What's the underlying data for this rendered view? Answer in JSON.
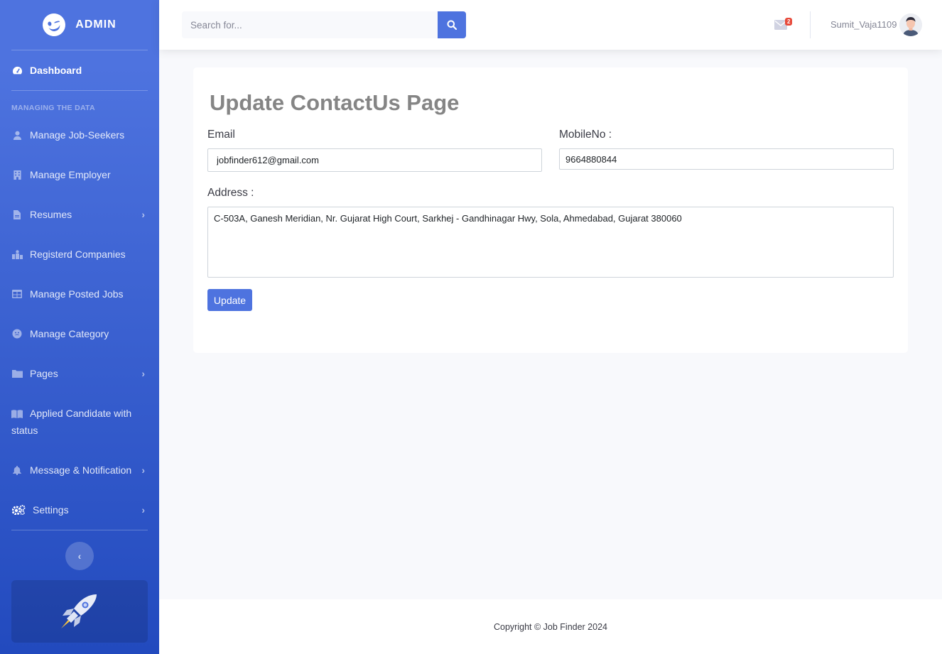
{
  "brand": {
    "name": "ADMIN",
    "icon": "laugh-wink-icon"
  },
  "sidebar": {
    "dashboard": "Dashboard",
    "heading": "MANAGING THE DATA",
    "items": [
      {
        "label": "Manage Job-Seekers",
        "icon": "user-icon",
        "chevron": false
      },
      {
        "label": "Manage Employer",
        "icon": "building-icon",
        "chevron": false
      },
      {
        "label": "Resumes",
        "icon": "file-icon",
        "chevron": true
      },
      {
        "label": "Registerd Companies",
        "icon": "companies-icon",
        "chevron": false
      },
      {
        "label": "Manage Posted Jobs",
        "icon": "table-icon",
        "chevron": false
      },
      {
        "label": "Manage Category",
        "icon": "category-icon",
        "chevron": false
      },
      {
        "label": "Pages",
        "icon": "folder-icon",
        "chevron": true
      },
      {
        "label": "Applied Candidate with status",
        "icon": "book-icon",
        "chevron": false
      },
      {
        "label": "Message & Notification",
        "icon": "bell-icon",
        "chevron": true
      },
      {
        "label": "Settings",
        "icon": "cogs-icon",
        "chevron": true
      }
    ]
  },
  "topbar": {
    "search_placeholder": "Search for...",
    "message_count": "2",
    "username": "Sumit_Vaja1109"
  },
  "main": {
    "title": "Update ContactUs Page",
    "email_label": "Email",
    "email_value": "jobfinder612@gmail.com",
    "mobile_label": "MobileNo :",
    "mobile_value": "9664880844",
    "address_label": "Address :",
    "address_value": "C-503A, Ganesh Meridian, Nr. Gujarat High Court, Sarkhej - Gandhinagar Hwy, Sola, Ahmedabad, Gujarat 380060",
    "update_label": "Update"
  },
  "footer": {
    "copyright": "Copyright © Job Finder 2024"
  },
  "colors": {
    "primary": "#4e73df",
    "badge": "#e74a3b",
    "background": "#f8f9fc"
  }
}
